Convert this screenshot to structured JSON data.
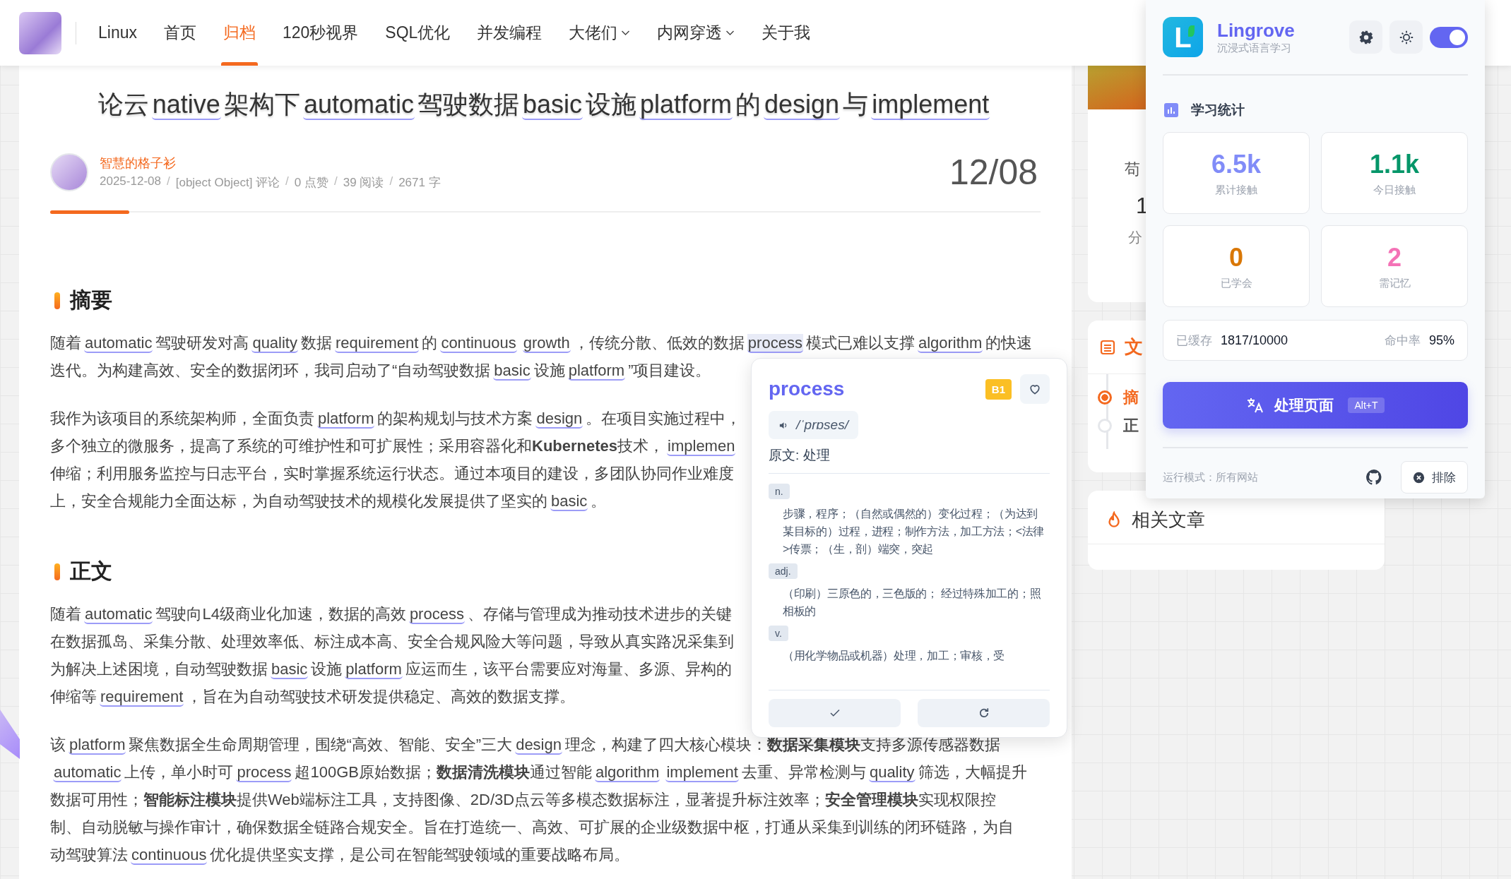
{
  "nav": {
    "items": [
      {
        "label": "Linux",
        "selected": false,
        "has_menu": false
      },
      {
        "label": "首页",
        "selected": false,
        "has_menu": false
      },
      {
        "label": "归档",
        "selected": true,
        "has_menu": false
      },
      {
        "label": "120秒视界",
        "selected": false,
        "has_menu": false
      },
      {
        "label": "SQL优化",
        "selected": false,
        "has_menu": false
      },
      {
        "label": "并发编程",
        "selected": false,
        "has_menu": false
      },
      {
        "label": "大佬们",
        "selected": false,
        "has_menu": true
      },
      {
        "label": "内网穿透",
        "selected": false,
        "has_menu": true
      },
      {
        "label": "关于我",
        "selected": false,
        "has_menu": false
      }
    ]
  },
  "article": {
    "title": [
      {
        "text": "论云",
        "kind": "plain"
      },
      {
        "text": "native",
        "kind": "word"
      },
      {
        "text": "架构下",
        "kind": "plain"
      },
      {
        "text": "automatic",
        "kind": "word"
      },
      {
        "text": "驾驶数据",
        "kind": "plain"
      },
      {
        "text": "basic",
        "kind": "word"
      },
      {
        "text": "设施",
        "kind": "plain"
      },
      {
        "text": "platform",
        "kind": "word"
      },
      {
        "text": "的",
        "kind": "plain"
      },
      {
        "text": "design",
        "kind": "word"
      },
      {
        "text": "与",
        "kind": "plain"
      },
      {
        "text": "implement",
        "kind": "word"
      }
    ],
    "author": "智慧的格子衫",
    "meta": [
      {
        "text": "2025-12-08",
        "kind": "value"
      },
      {
        "text": "/",
        "kind": "separator"
      },
      {
        "text": "[object Object] 评论",
        "kind": "value"
      },
      {
        "text": "/",
        "kind": "separator"
      },
      {
        "text": "0 点赞",
        "kind": "value"
      },
      {
        "text": "/",
        "kind": "separator"
      },
      {
        "text": "39 阅读",
        "kind": "value"
      },
      {
        "text": "/",
        "kind": "separator"
      },
      {
        "text": "2671 字",
        "kind": "value"
      }
    ],
    "date": "12/08",
    "reading_progress": {
      "level": 0.08
    },
    "sections": [
      {
        "heading": "摘要",
        "paragraphs": [
          [
            [
              {
                "text": "随着",
                "kind": "plain"
              },
              {
                "text": "automatic",
                "kind": "word"
              },
              {
                "text": "驾驶研发对高",
                "kind": "plain"
              },
              {
                "text": "quality",
                "kind": "word"
              },
              {
                "text": "数据",
                "kind": "plain"
              },
              {
                "text": "requirement",
                "kind": "word"
              },
              {
                "text": "的",
                "kind": "plain"
              },
              {
                "text": "continuous",
                "kind": "word"
              },
              {
                "text": "growth",
                "kind": "word"
              },
              {
                "text": "，传统分散、低效的数据",
                "kind": "plain"
              },
              {
                "text": "process",
                "kind": "active"
              },
              {
                "text": "模式已难以支撑",
                "kind": "plain"
              },
              {
                "text": "algorithm",
                "kind": "word"
              },
              {
                "text": "的快速",
                "kind": "plain"
              }
            ],
            [
              {
                "text": "迭代。为构建高效、安全的数据闭环，我司启动了“自动驾驶数据",
                "kind": "plain"
              },
              {
                "text": "basic",
                "kind": "word"
              },
              {
                "text": "设施",
                "kind": "plain"
              },
              {
                "text": "platform",
                "kind": "word"
              },
              {
                "text": "”项目建设。",
                "kind": "plain"
              }
            ]
          ],
          [
            [
              {
                "text": "我作为该项目的系统架构师，全面负责",
                "kind": "plain"
              },
              {
                "text": "platform",
                "kind": "word"
              },
              {
                "text": "的架构规划与技术方案",
                "kind": "plain"
              },
              {
                "text": "design",
                "kind": "word"
              },
              {
                "text": "。在项目实施过程中，",
                "kind": "plain"
              }
            ],
            [
              {
                "text": "多个独立的微服务，提高了系统的可维护性和可扩展性；采用容器化和",
                "kind": "plain"
              },
              {
                "text": "Kubernetes",
                "kind": "bold"
              },
              {
                "text": "技术，",
                "kind": "plain"
              },
              {
                "text": "implemen",
                "kind": "word"
              }
            ],
            [
              {
                "text": "伸缩；利用服务监控与日志平台，实时掌握系统运行状态。通过本项目的建设，多团队协同作业难度",
                "kind": "plain"
              }
            ],
            [
              {
                "text": "上，安全合规能力全面达标，为自动驾驶技术的规模化发展提供了坚实的",
                "kind": "plain"
              },
              {
                "text": "basic",
                "kind": "word"
              },
              {
                "text": "。",
                "kind": "plain"
              }
            ]
          ]
        ]
      },
      {
        "heading": "正文",
        "paragraphs": [
          [
            [
              {
                "text": "随着",
                "kind": "plain"
              },
              {
                "text": "automatic",
                "kind": "word"
              },
              {
                "text": "驾驶向L4级商业化加速，数据的高效",
                "kind": "plain"
              },
              {
                "text": "process",
                "kind": "word"
              },
              {
                "text": "、存储与管理成为推动技术进步的关键",
                "kind": "plain"
              }
            ],
            [
              {
                "text": "在数据孤岛、采集分散、处理效率低、标注成本高、安全合规风险大等问题，导致从真实路况采集到",
                "kind": "plain"
              }
            ],
            [
              {
                "text": "为解决上述困境，自动驾驶数据",
                "kind": "plain"
              },
              {
                "text": "basic",
                "kind": "word"
              },
              {
                "text": "设施",
                "kind": "plain"
              },
              {
                "text": "platform",
                "kind": "word"
              },
              {
                "text": "应运而生，该平台需要应对海量、多源、异构的",
                "kind": "plain"
              }
            ],
            [
              {
                "text": "伸缩等",
                "kind": "plain"
              },
              {
                "text": "requirement",
                "kind": "word"
              },
              {
                "text": "，旨在为自动驾驶技术研发提供稳定、高效的数据支撑。",
                "kind": "plain"
              }
            ]
          ],
          [
            [
              {
                "text": "该",
                "kind": "plain"
              },
              {
                "text": "platform",
                "kind": "word"
              },
              {
                "text": "聚焦数据全生命周期管理，围绕“高效、智能、安全”三大",
                "kind": "plain"
              },
              {
                "text": "design",
                "kind": "word"
              },
              {
                "text": "理念，构建了四大核心模块：",
                "kind": "plain"
              },
              {
                "text": "数据采集模块",
                "kind": "bold"
              },
              {
                "text": "支持多源传感器数据",
                "kind": "plain"
              }
            ],
            [
              {
                "text": "automatic",
                "kind": "word"
              },
              {
                "text": "上传，单小时可",
                "kind": "plain"
              },
              {
                "text": "process",
                "kind": "word"
              },
              {
                "text": "超100GB原始数据；",
                "kind": "plain"
              },
              {
                "text": "数据清洗模块",
                "kind": "bold"
              },
              {
                "text": "通过智能",
                "kind": "plain"
              },
              {
                "text": "algorithm",
                "kind": "word"
              },
              {
                "text": "implement",
                "kind": "word"
              },
              {
                "text": "去重、异常检测与",
                "kind": "plain"
              },
              {
                "text": "quality",
                "kind": "word"
              },
              {
                "text": "筛选，大幅提升",
                "kind": "plain"
              }
            ],
            [
              {
                "text": "数据可用性；",
                "kind": "plain"
              },
              {
                "text": "智能标注模块",
                "kind": "bold"
              },
              {
                "text": "提供Web端标注工具，支持图像、2D/3D点云等多模态数据标注，显著提升标注效率；",
                "kind": "plain"
              },
              {
                "text": "安全管理模块",
                "kind": "bold"
              },
              {
                "text": "实现权限控",
                "kind": "plain"
              }
            ],
            [
              {
                "text": "制、自动脱敏与操作审计，确保数据全链路合规安全。旨在打造统一、高效、可扩展的企业级数据中枢，打通从采集到训练的闭环链路，为自",
                "kind": "plain"
              }
            ],
            [
              {
                "text": "动驾驶算法",
                "kind": "plain"
              },
              {
                "text": "continuous",
                "kind": "word"
              },
              {
                "text": "优化提供坚实支撑，是公司在智能驾驶领域的重要战略布局。",
                "kind": "plain"
              }
            ]
          ]
        ]
      }
    ]
  },
  "sidebar": {
    "profile_card": {
      "name": "苟",
      "count": "1",
      "count_label": "分"
    },
    "toc_card": {
      "title": "文",
      "items": [
        {
          "label": "摘",
          "selected": true
        },
        {
          "label": "正",
          "selected": false
        }
      ]
    },
    "related_card": {
      "title": "相关文章"
    }
  },
  "word_popup": {
    "word": "process",
    "level_badge": "B1",
    "favorited": false,
    "phonetic": "/ˈprɒses/",
    "original": "原文: 处理",
    "definitions": [
      {
        "pos": "n.",
        "text": "步骤，程序；（自然或偶然的）变化过程；（为达到某目标的）过程，进程；制作方法，加工方法；<法律>传票；（生，剖）端突，突起"
      },
      {
        "pos": "adj.",
        "text": "（印刷）三原色的，三色版的； 经过特殊加工的；照相板的"
      },
      {
        "pos": "v.",
        "text": "（用化学物品或机器）处理，加工；审核，受"
      }
    ]
  },
  "extension_panel": {
    "logo_letter": "L",
    "title": "Lingrove",
    "subtitle": "沉浸式语言学习",
    "enabled": true,
    "section_title": "学习统计",
    "stats": [
      {
        "value": "6.5k",
        "label": "累计接触",
        "color": "#818cf8"
      },
      {
        "value": "1.1k",
        "label": "今日接触",
        "color": "#059669"
      },
      {
        "value": "0",
        "label": "已学会",
        "color": "#d97706"
      },
      {
        "value": "2",
        "label": "需记忆",
        "color": "#f472b6"
      }
    ],
    "cache": {
      "label": "已缓存",
      "value": "1817/10000",
      "hit_label": "命中率",
      "hit_value": "95%"
    },
    "action": {
      "label": "处理页面",
      "shortcut": "Alt+T"
    },
    "mode": "运行模式：所有网站",
    "exclude": "排除"
  }
}
